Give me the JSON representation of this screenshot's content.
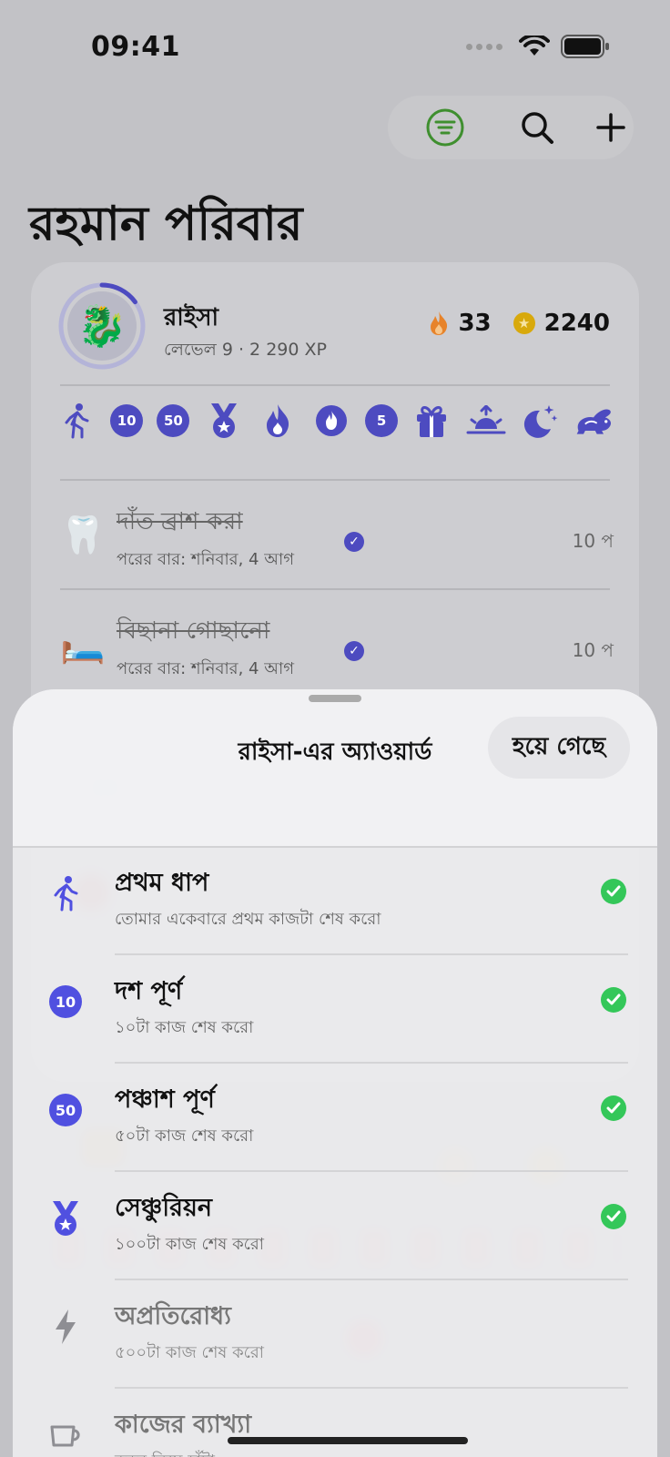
{
  "status_bar": {
    "time": "09:41"
  },
  "toolbar": {
    "filter_icon": "filter-icon",
    "search_icon": "search-icon",
    "add_icon": "plus-icon"
  },
  "family": {
    "title": "রহমান পরিবার"
  },
  "child": {
    "name": "রাইসা",
    "level_text": "লেভেল 9 · 2 290 XP",
    "streak": "33",
    "coins": "2240",
    "avatar_emoji": "🐉",
    "level_progress": 0.15
  },
  "badges": [
    {
      "type": "icon",
      "name": "walker-icon"
    },
    {
      "type": "number",
      "label": "10"
    },
    {
      "type": "number",
      "label": "50"
    },
    {
      "type": "icon",
      "name": "medal-icon"
    },
    {
      "type": "icon",
      "name": "flame-icon"
    },
    {
      "type": "icon",
      "name": "flame-circle-icon"
    },
    {
      "type": "number",
      "label": "5"
    },
    {
      "type": "icon",
      "name": "gift-icon"
    },
    {
      "type": "icon",
      "name": "sunrise-icon"
    },
    {
      "type": "icon",
      "name": "moon-stars-icon"
    },
    {
      "type": "icon",
      "name": "hare-icon"
    }
  ],
  "chores": [
    {
      "emoji": "🦷",
      "title": "দাঁত ব্রাশ করা",
      "subtitle": "পরের বার: শনিবার, 4 আগ",
      "points": "10 প"
    },
    {
      "emoji": "🛏️",
      "title": "বিছানা গোছানো",
      "subtitle": "পরের বার: শনিবার, 4 আগ",
      "points": "10 প"
    }
  ],
  "sheet": {
    "title": "রাইসা-এর অ্যাওয়ার্ড",
    "done_label": "হয়ে গেছে",
    "awards": [
      {
        "icon": "walker-icon",
        "title": "প্রথম ধাপ",
        "subtitle": "তোমার একেবারে প্রথম কাজটা শেষ করো",
        "earned": true
      },
      {
        "icon": "number",
        "number": "10",
        "title": "দশ পূর্ণ",
        "subtitle": "১০টা কাজ শেষ করো",
        "earned": true
      },
      {
        "icon": "number",
        "number": "50",
        "title": "পঞ্চাশ পূর্ণ",
        "subtitle": "৫০টা কাজ শেষ করো",
        "earned": true
      },
      {
        "icon": "medal-icon",
        "title": "সেঞ্চুরিয়ন",
        "subtitle": "১০০টা কাজ শেষ করো",
        "earned": true
      },
      {
        "icon": "bolt-icon",
        "title": "অপ্রতিরোধ্য",
        "subtitle": "৫০০টা কাজ শেষ করো",
        "earned": false
      },
      {
        "icon": "cup-icon",
        "title": "কাজের ব্যাখ্যা",
        "subtitle": "কুকুর নিয়ে হাঁটা",
        "earned": false
      }
    ]
  },
  "colors": {
    "accent": "#4d4bc0",
    "award_blue": "#5050e0",
    "check_green": "#34c759",
    "filter_green": "#3f8f2f",
    "flame": "#e7832a",
    "coin": "#d8a90c"
  }
}
